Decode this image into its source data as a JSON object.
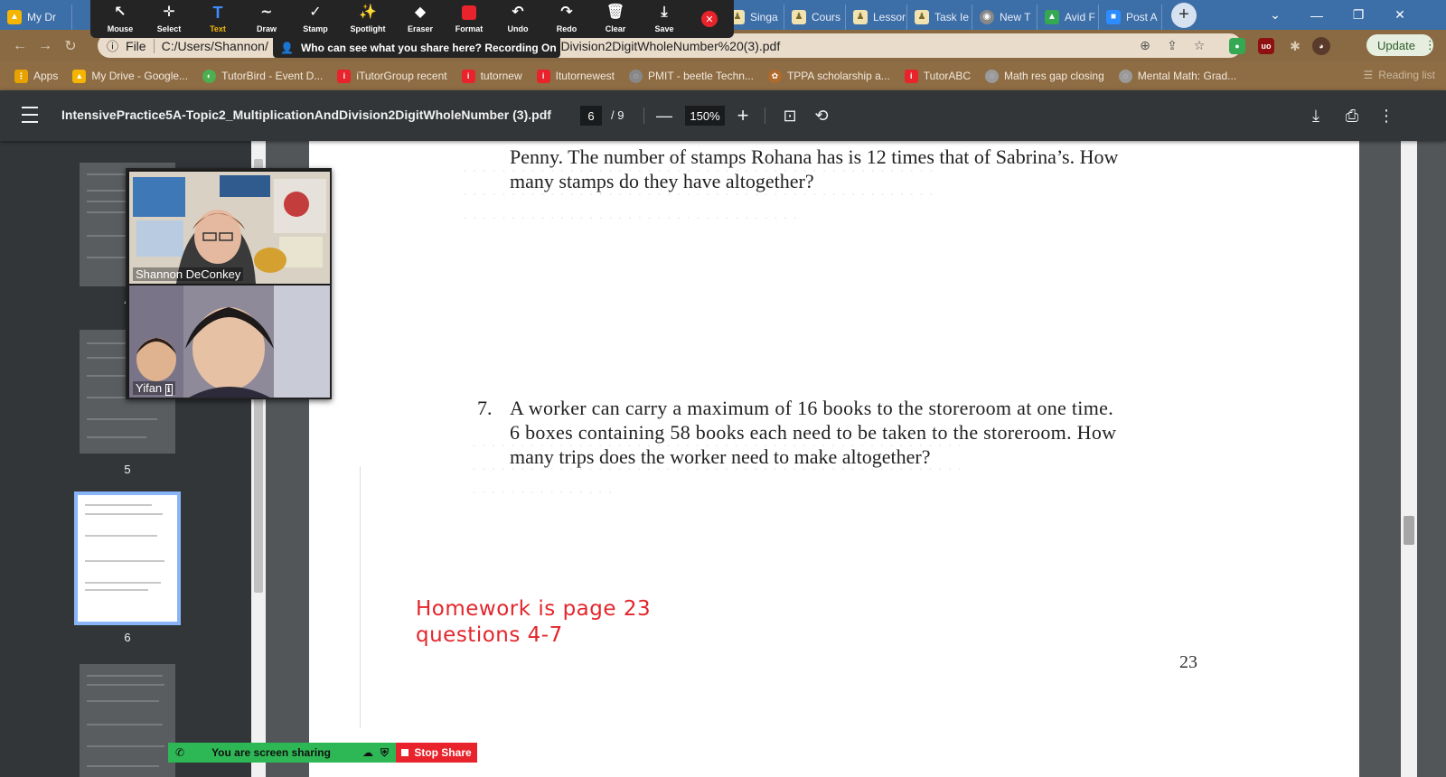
{
  "browser": {
    "tabs": [
      {
        "label": "My Dr",
        "color": "#f4b400"
      },
      {
        "label": "Singa",
        "color": "#f1e3b0"
      },
      {
        "label": "Cours",
        "color": "#f1e3b0"
      },
      {
        "label": "Lessor",
        "color": "#f1e3b0"
      },
      {
        "label": "Task Ie",
        "color": "#f1e3b0"
      },
      {
        "label": "New T",
        "color": "#888888"
      },
      {
        "label": "Avid F",
        "color": "#34a853"
      },
      {
        "label": "Post A",
        "color": "#2d8cff"
      }
    ],
    "address": "C:/Users/Shannon/",
    "address_tail": "ndDivision2DigitWholeNumber%20(3).pdf",
    "file_label": "File",
    "update_label": "Update"
  },
  "annotation_toolbar": {
    "tools": [
      {
        "label": "Mouse",
        "icon": "↖"
      },
      {
        "label": "Select",
        "icon": "✛"
      },
      {
        "label": "Text",
        "icon": "T"
      },
      {
        "label": "Draw",
        "icon": "∼"
      },
      {
        "label": "Stamp",
        "icon": "✓"
      },
      {
        "label": "Spotlight",
        "icon": "✨"
      },
      {
        "label": "Eraser",
        "icon": "◆"
      },
      {
        "label": "Format",
        "icon": "■"
      },
      {
        "label": "Undo",
        "icon": "↶"
      },
      {
        "label": "Redo",
        "icon": "↷"
      },
      {
        "label": "Clear",
        "icon": "✖"
      },
      {
        "label": "Save",
        "icon": "⤓"
      }
    ],
    "recording_text": "Who can see what you share here? Recording On"
  },
  "bookmarks": [
    {
      "label": "Apps",
      "color": "#e8a200"
    },
    {
      "label": "My Drive - Google...",
      "color": "#f4b400"
    },
    {
      "label": "TutorBird - Event D...",
      "color": "#4caf50"
    },
    {
      "label": "iTutorGroup recent",
      "color": "#e8232b"
    },
    {
      "label": "tutornew",
      "color": "#e8232b"
    },
    {
      "label": "Itutornewest",
      "color": "#e8232b"
    },
    {
      "label": "PMIT - beetle Techn...",
      "color": "#888888"
    },
    {
      "label": "TPPA scholarship a...",
      "color": "#b06b2c"
    },
    {
      "label": "TutorABC",
      "color": "#e8232b"
    },
    {
      "label": "Math res gap closing",
      "color": "#9a9a9a"
    },
    {
      "label": "Mental Math: Grad...",
      "color": "#9a9a9a"
    }
  ],
  "reading_list": "Reading list",
  "pdf": {
    "title": "IntensivePractice5A-Topic2_MultiplicationAndDivision2DigitWholeNumber (3).pdf",
    "page": "6",
    "total": "/  9",
    "zoom": "150%",
    "thumb_labels": [
      "4",
      "5",
      "6"
    ],
    "question6_line1": "Penny. The number of stamps Rohana has is 12 times that of Sabrina’s. How",
    "question6_line2": "many stamps do they have altogether?",
    "question7_number": "7.",
    "question7_line1": "A worker can carry a maximum of 16 books to the storeroom at one time.",
    "question7_line2": "6 boxes containing 58 books each need to be taken to the storeroom. How",
    "question7_line3": "many trips does the worker need to make altogether?",
    "homework_line1": "Homework is page 23",
    "homework_line2": "questions 4-7",
    "page_number": "23"
  },
  "zoom_call": {
    "participant1": "Shannon DeConkey",
    "participant2": "Yifan",
    "share_status": "You are screen sharing",
    "stop_share": "Stop Share"
  }
}
